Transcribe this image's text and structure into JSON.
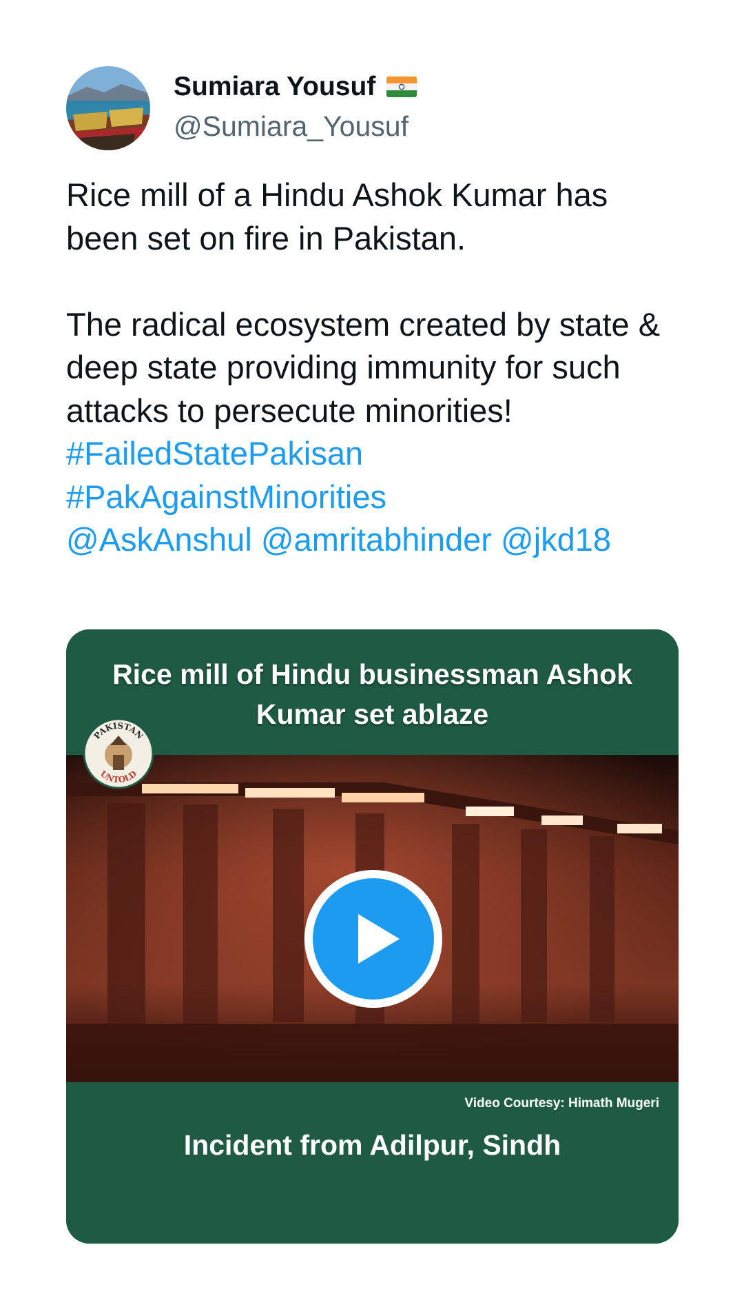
{
  "author": {
    "display_name": "Sumiara Yousuf",
    "handle": "@Sumiara_Yousuf",
    "badge_icon": "india-flag-emoji"
  },
  "tweet": {
    "paragraph1": "Rice mill of a Hindu Ashok Kumar has been set on fire in Pakistan.",
    "paragraph2": "The radical ecosystem created by state & deep state providing immunity for such attacks to persecute minorities!",
    "hashtags": [
      "#FailedStatePakisan",
      "#PakAgainstMinorities"
    ],
    "mentions": [
      "@AskAnshul",
      "@amritabhinder",
      "@jkd18"
    ]
  },
  "media": {
    "headline": "Rice mill of Hindu businessman Ashok Kumar set ablaze",
    "logo_text_top": "PAKISTAN",
    "logo_text_bottom": "UNTOLD",
    "courtesy": "Video Courtesy: Himath Mugeri",
    "caption": "Incident from Adilpur, Sindh",
    "play_icon": "play-icon",
    "colors": {
      "banner": "#1f5a45",
      "play_button": "#1d9bf0",
      "link": "#1d9bf0"
    }
  }
}
